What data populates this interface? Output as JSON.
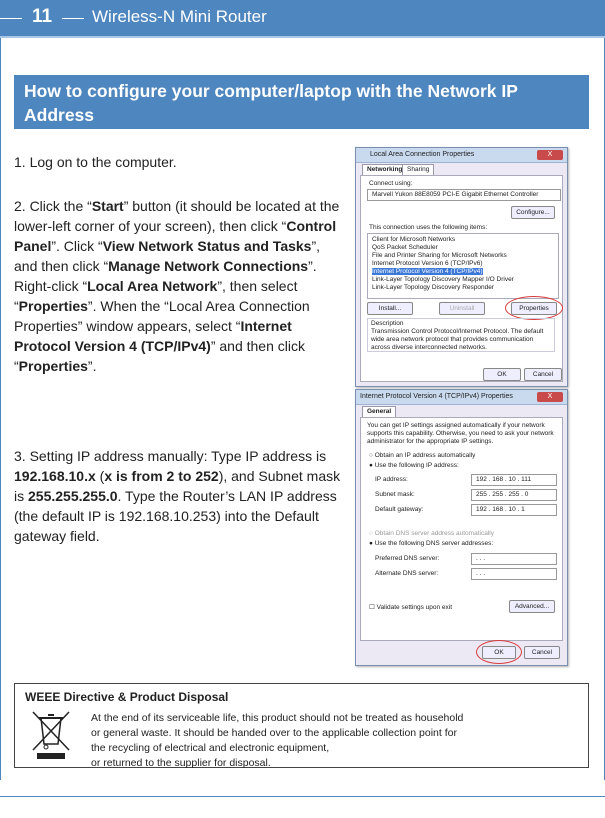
{
  "header": {
    "page_number": "11",
    "title": "Wireless-N Mini Router"
  },
  "section_title": "How to configure your computer/laptop with the Network IP Address",
  "steps": {
    "step1": "1. Log on to the computer.",
    "step2_parts": [
      "2. Click the “",
      "Start",
      "” button (it should be located at the lower-left corner of your screen), then click “",
      "Control Panel",
      "”. Click “",
      "View Network Status and Tasks",
      "”, and then click “",
      "Manage Network Connections",
      "”. Right-click “",
      "Local Area Network",
      "”, then select “",
      "Properties",
      "”. When the “Local Area Connection Properties” window appears, select “",
      "Internet Protocol Version 4 (TCP/IPv4)",
      "” and then click “",
      "Properties",
      "”."
    ],
    "step3_parts": [
      "3. Setting IP address manually: Type IP address is ",
      "192.168.10.x",
      " (",
      "x is from 2 to 252",
      "), and Subnet mask is ",
      "255.255.255.0",
      ". Type the Router’s LAN IP address (the default IP is 192.168.10.253) into the Default gateway field."
    ]
  },
  "win1": {
    "title": "Local Area Connection Properties",
    "close": "X",
    "tabs": [
      "Networking",
      "Sharing"
    ],
    "connect_using_label": "Connect using:",
    "adapter": "Marvell Yukon 88E8059 PCI-E Gigabit Ethernet Controller",
    "configure_btn": "Configure...",
    "items_label": "This connection uses the following items:",
    "items": [
      "Client for Microsoft Networks",
      "QoS Packet Scheduler",
      "File and Printer Sharing for Microsoft Networks",
      "Internet Protocol Version 6 (TCP/IPv6)",
      "Internet Protocol Version 4 (TCP/IPv4)",
      "Link-Layer Topology Discovery Mapper I/O Driver",
      "Link-Layer Topology Discovery Responder"
    ],
    "install_btn": "Install...",
    "uninstall_btn": "Uninstall",
    "properties_btn": "Properties",
    "description_label": "Description",
    "description": "Transmission Control Protocol/Internet Protocol. The default wide area network protocol that provides communication across diverse interconnected networks.",
    "ok_btn": "OK",
    "cancel_btn": "Cancel"
  },
  "win2": {
    "title": "Internet Protocol Version 4 (TCP/IPv4) Properties",
    "close": "X",
    "tab": "General",
    "intro": "You can get IP settings assigned automatically if your network supports this capability. Otherwise, you need to ask your network administrator for the appropriate IP settings.",
    "opt_auto_ip": "Obtain an IP address automatically",
    "opt_manual_ip": "Use the following IP address:",
    "ip_label": "IP address:",
    "ip_value": "192 . 168 . 10 . 111",
    "mask_label": "Subnet mask:",
    "mask_value": "255 . 255 . 255 . 0",
    "gw_label": "Default gateway:",
    "gw_value": "192 . 168 . 10 . 1",
    "opt_auto_dns": "Obtain DNS server address automatically",
    "opt_manual_dns": "Use the following DNS server addresses:",
    "pdns_label": "Preferred DNS server:",
    "adns_label": "Alternate DNS server:",
    "dns_blank": ".    .    .",
    "validate": "Validate settings upon exit",
    "advanced_btn": "Advanced...",
    "ok_btn": "OK",
    "cancel_btn": "Cancel"
  },
  "weee": {
    "title": "WEEE Directive & Product Disposal",
    "lines": [
      "At the end of its serviceable life, this product should not be treated as household",
      "or general waste. It should be handed over to the applicable collection point for",
      "the recycling of electrical and electronic equipment,",
      "or returned to the supplier for disposal."
    ]
  }
}
